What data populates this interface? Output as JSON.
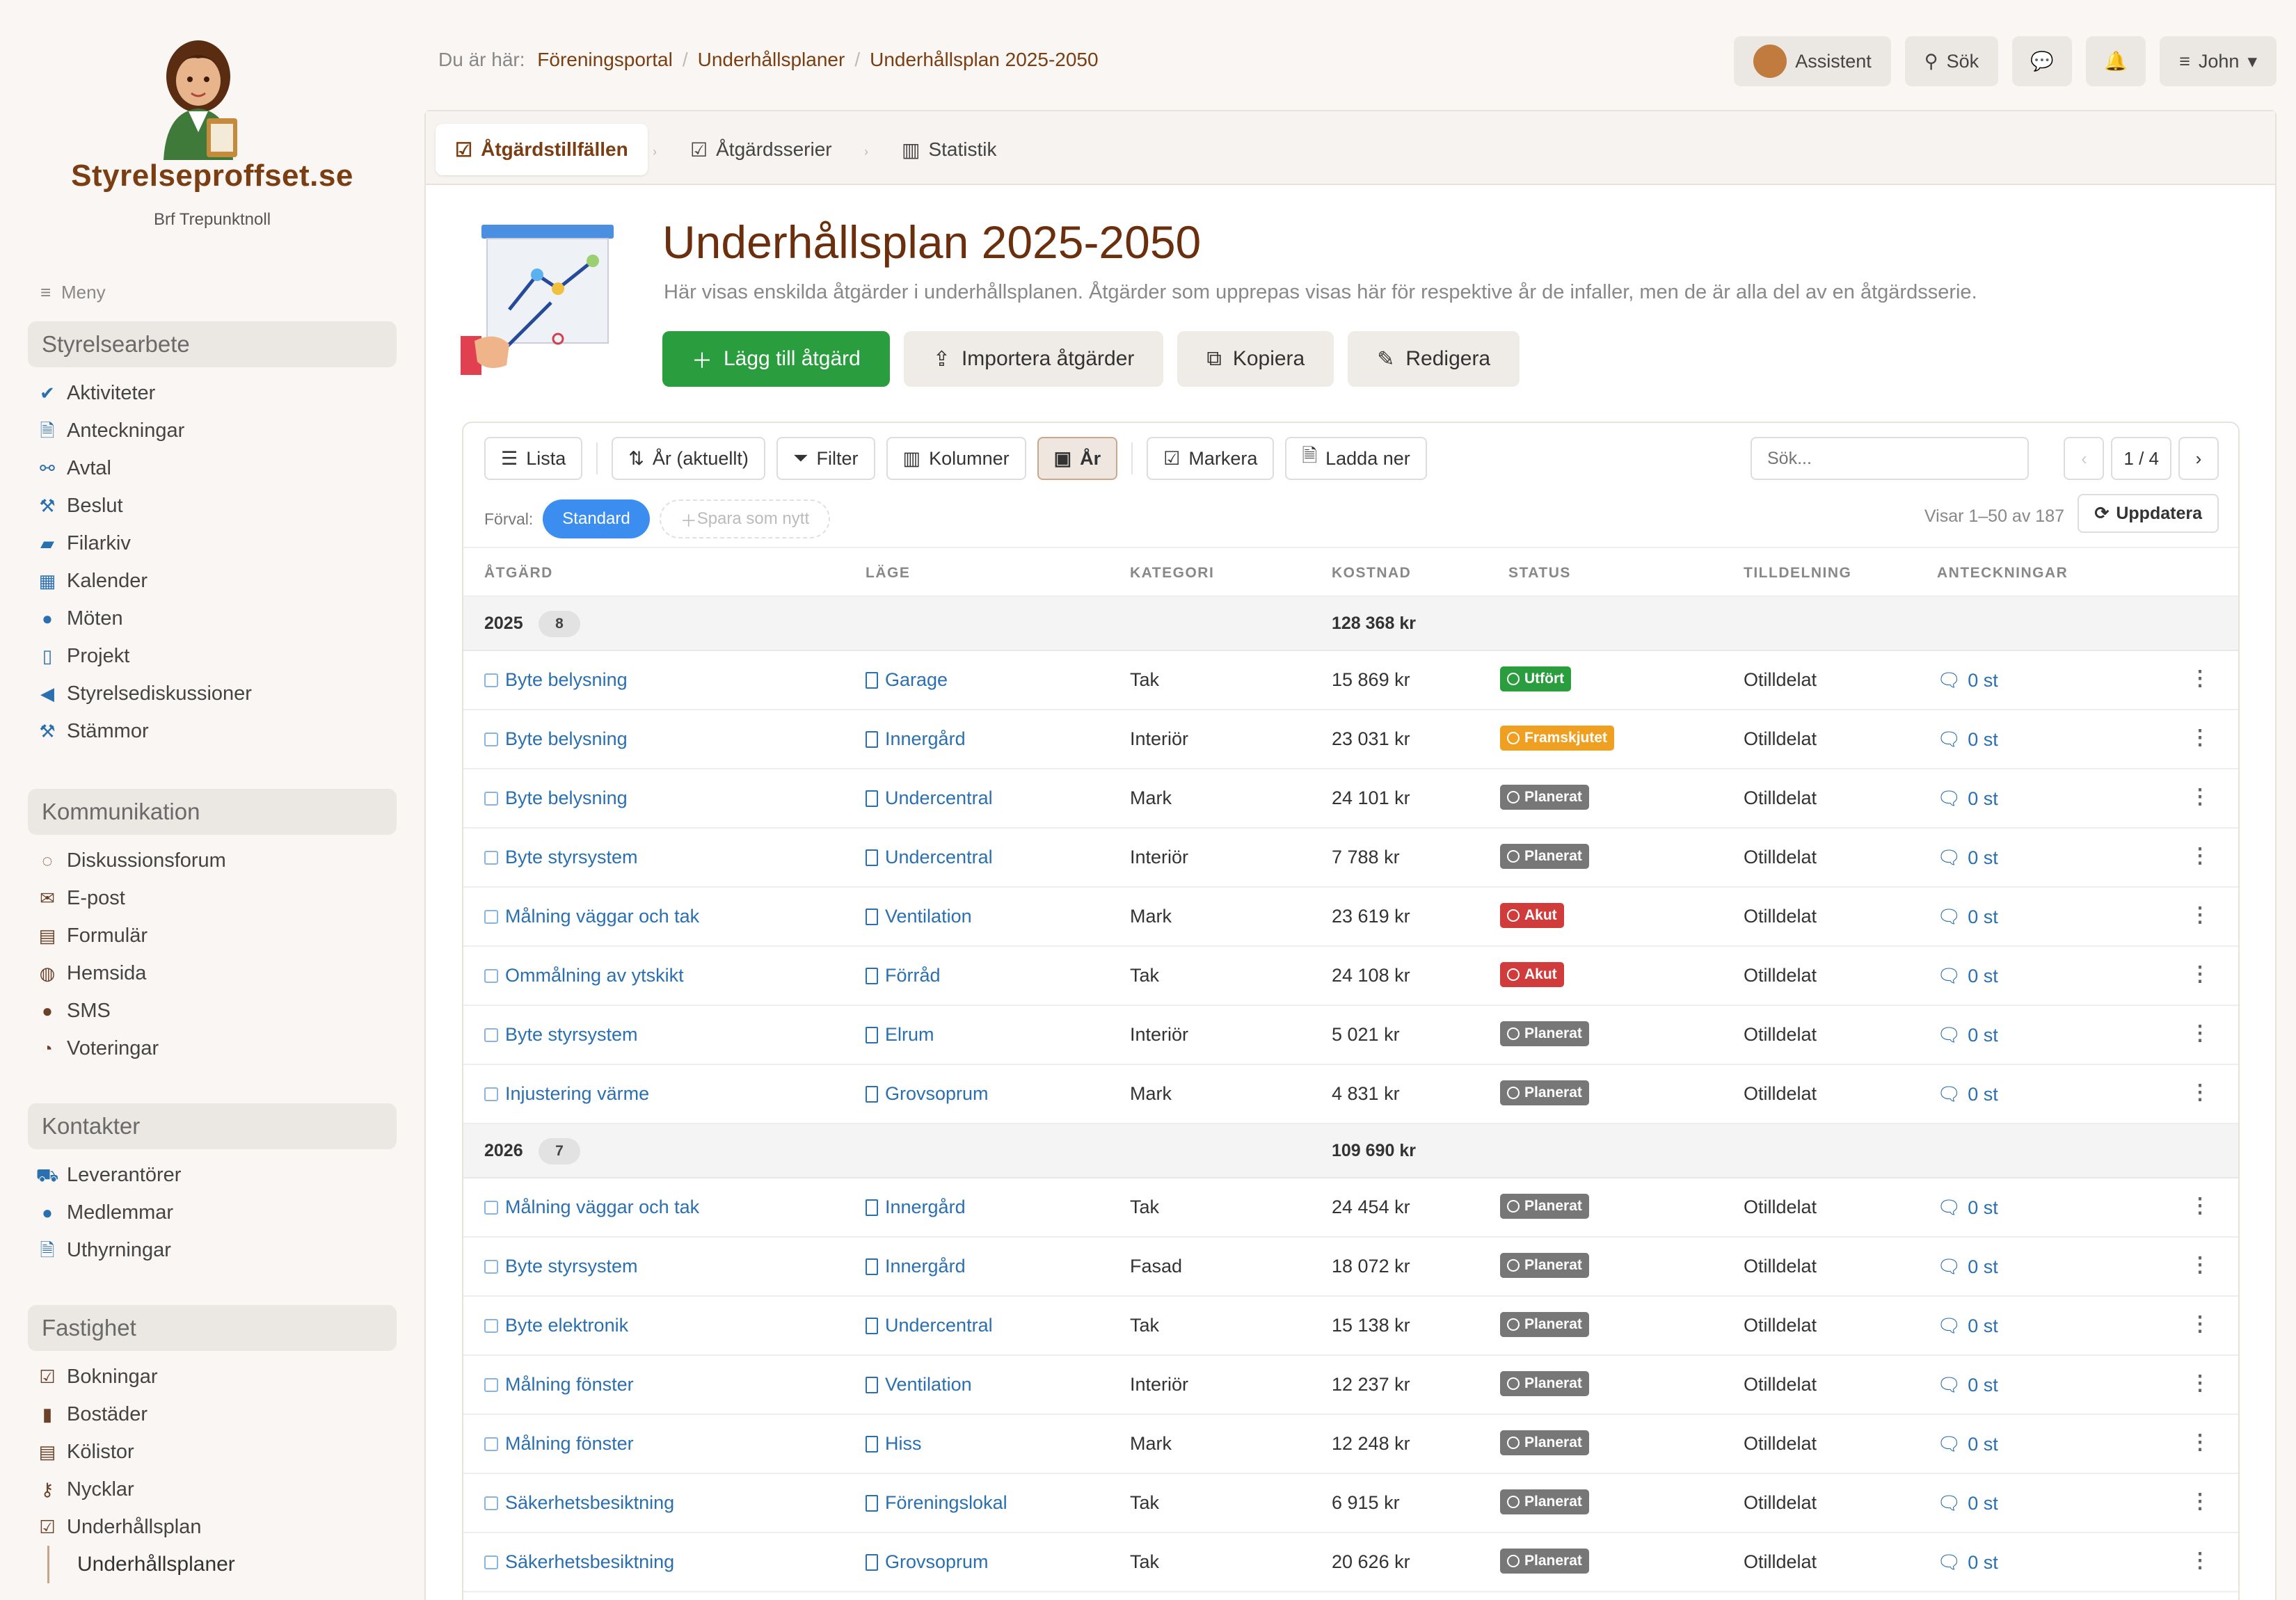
{
  "brand": {
    "name": "Styrelseproffset.se",
    "subtitle": "Brf Trepunktnoll"
  },
  "menu_label": "Meny",
  "nav": [
    {
      "title": "Styrelsearbete",
      "items": [
        {
          "label": "Aktiviteter",
          "icon": "check-icon"
        },
        {
          "label": "Anteckningar",
          "icon": "file-icon"
        },
        {
          "label": "Avtal",
          "icon": "handshake-icon"
        },
        {
          "label": "Beslut",
          "icon": "gavel-icon"
        },
        {
          "label": "Filarkiv",
          "icon": "folder-icon"
        },
        {
          "label": "Kalender",
          "icon": "calendar-icon"
        },
        {
          "label": "Möten",
          "icon": "chat-bubble-icon"
        },
        {
          "label": "Projekt",
          "icon": "building-icon"
        },
        {
          "label": "Styrelsediskussioner",
          "icon": "megaphone-icon"
        },
        {
          "label": "Stämmor",
          "icon": "gavel-icon"
        }
      ]
    },
    {
      "title": "Kommunikation",
      "items": [
        {
          "label": "Diskussionsforum",
          "icon": "comments-icon"
        },
        {
          "label": "E-post",
          "icon": "envelope-icon"
        },
        {
          "label": "Formulär",
          "icon": "form-icon"
        },
        {
          "label": "Hemsida",
          "icon": "globe-icon"
        },
        {
          "label": "SMS",
          "icon": "sms-icon"
        },
        {
          "label": "Voteringar",
          "icon": "pie-chart-icon"
        }
      ]
    },
    {
      "title": "Kontakter",
      "items": [
        {
          "label": "Leverantörer",
          "icon": "truck-icon"
        },
        {
          "label": "Medlemmar",
          "icon": "user-icon"
        },
        {
          "label": "Uthyrningar",
          "icon": "file-icon"
        }
      ]
    },
    {
      "title": "Fastighet",
      "items": [
        {
          "label": "Bokningar",
          "icon": "calendar-check-icon"
        },
        {
          "label": "Bostäder",
          "icon": "building-icon"
        },
        {
          "label": "Kölistor",
          "icon": "list-icon"
        },
        {
          "label": "Nycklar",
          "icon": "key-icon"
        },
        {
          "label": "Underhållsplan",
          "icon": "calendar-check-icon"
        }
      ],
      "sub": "Underhållsplaner"
    }
  ],
  "breadcrumb": {
    "prefix": "Du är här:",
    "items": [
      "Föreningsportal",
      "Underhållsplaner",
      "Underhållsplan 2025-2050"
    ]
  },
  "topbar": {
    "assistant": "Assistent",
    "search": "Sök",
    "user": "John"
  },
  "tabs": [
    "Åtgärdstillfällen",
    "Åtgärdsserier",
    "Statistik"
  ],
  "page": {
    "title": "Underhållsplan 2025-2050",
    "description": "Här visas enskilda åtgärder i underhållsplanen. Åtgärder som upprepas visas här för respektive år de infaller, men de är alla del av en åtgärdsserie.",
    "actions": [
      "Lägg till åtgärd",
      "Importera åtgärder",
      "Kopiera",
      "Redigera"
    ]
  },
  "toolbar": {
    "buttons": [
      "Lista",
      "År (aktuellt)",
      "Filter",
      "Kolumner",
      "År",
      "Markera",
      "Ladda ner"
    ],
    "search_placeholder": "Sök...",
    "page": "1 / 4",
    "preset_label": "Förval:",
    "preset_active": "Standard",
    "preset_save": "Spara som nytt",
    "showing": "Visar 1–50 av 187",
    "refresh": "Uppdatera"
  },
  "columns": [
    "ÅTGÄRD",
    "LÄGE",
    "KATEGORI",
    "KOSTNAD",
    "STATUS",
    "TILLDELNING",
    "ANTECKNINGAR"
  ],
  "groups": [
    {
      "year": "2025",
      "count": "8",
      "sum": "128 368 kr",
      "rows": [
        {
          "atgard": "Byte belysning",
          "lage": "Garage",
          "kategori": "Tak",
          "kostnad": "15 869 kr",
          "status": "Utfört",
          "tilldelning": "Otilldelat",
          "anteckningar": "0 st"
        },
        {
          "atgard": "Byte belysning",
          "lage": "Innergård",
          "kategori": "Interiör",
          "kostnad": "23 031 kr",
          "status": "Framskjutet",
          "tilldelning": "Otilldelat",
          "anteckningar": "0 st"
        },
        {
          "atgard": "Byte belysning",
          "lage": "Undercentral",
          "kategori": "Mark",
          "kostnad": "24 101 kr",
          "status": "Planerat",
          "tilldelning": "Otilldelat",
          "anteckningar": "0 st"
        },
        {
          "atgard": "Byte styrsystem",
          "lage": "Undercentral",
          "kategori": "Interiör",
          "kostnad": "7 788 kr",
          "status": "Planerat",
          "tilldelning": "Otilldelat",
          "anteckningar": "0 st"
        },
        {
          "atgard": "Målning väggar och tak",
          "lage": "Ventilation",
          "kategori": "Mark",
          "kostnad": "23 619 kr",
          "status": "Akut",
          "tilldelning": "Otilldelat",
          "anteckningar": "0 st"
        },
        {
          "atgard": "Ommålning av ytskikt",
          "lage": "Förråd",
          "kategori": "Tak",
          "kostnad": "24 108 kr",
          "status": "Akut",
          "tilldelning": "Otilldelat",
          "anteckningar": "0 st"
        },
        {
          "atgard": "Byte styrsystem",
          "lage": "Elrum",
          "kategori": "Interiör",
          "kostnad": "5 021 kr",
          "status": "Planerat",
          "tilldelning": "Otilldelat",
          "anteckningar": "0 st"
        },
        {
          "atgard": "Injustering värme",
          "lage": "Grovsoprum",
          "kategori": "Mark",
          "kostnad": "4 831 kr",
          "status": "Planerat",
          "tilldelning": "Otilldelat",
          "anteckningar": "0 st"
        }
      ]
    },
    {
      "year": "2026",
      "count": "7",
      "sum": "109 690 kr",
      "rows": [
        {
          "atgard": "Målning väggar och tak",
          "lage": "Innergård",
          "kategori": "Tak",
          "kostnad": "24 454 kr",
          "status": "Planerat",
          "tilldelning": "Otilldelat",
          "anteckningar": "0 st"
        },
        {
          "atgard": "Byte styrsystem",
          "lage": "Innergård",
          "kategori": "Fasad",
          "kostnad": "18 072 kr",
          "status": "Planerat",
          "tilldelning": "Otilldelat",
          "anteckningar": "0 st"
        },
        {
          "atgard": "Byte elektronik",
          "lage": "Undercentral",
          "kategori": "Tak",
          "kostnad": "15 138 kr",
          "status": "Planerat",
          "tilldelning": "Otilldelat",
          "anteckningar": "0 st"
        },
        {
          "atgard": "Målning fönster",
          "lage": "Ventilation",
          "kategori": "Interiör",
          "kostnad": "12 237 kr",
          "status": "Planerat",
          "tilldelning": "Otilldelat",
          "anteckningar": "0 st"
        },
        {
          "atgard": "Målning fönster",
          "lage": "Hiss",
          "kategori": "Mark",
          "kostnad": "12 248 kr",
          "status": "Planerat",
          "tilldelning": "Otilldelat",
          "anteckningar": "0 st"
        },
        {
          "atgard": "Säkerhetsbesiktning",
          "lage": "Föreningslokal",
          "kategori": "Tak",
          "kostnad": "6 915 kr",
          "status": "Planerat",
          "tilldelning": "Otilldelat",
          "anteckningar": "0 st"
        },
        {
          "atgard": "Säkerhetsbesiktning",
          "lage": "Grovsoprum",
          "kategori": "Tak",
          "kostnad": "20 626 kr",
          "status": "Planerat",
          "tilldelning": "Otilldelat",
          "anteckningar": "0 st"
        }
      ]
    }
  ],
  "colors": {
    "brand": "#7a3e12",
    "primary_action": "#2a9d3f",
    "link": "#2a6fb0",
    "done": "#2a9d3f",
    "postponed": "#f0a020",
    "planned": "#777777",
    "urgent": "#d03b3b"
  }
}
